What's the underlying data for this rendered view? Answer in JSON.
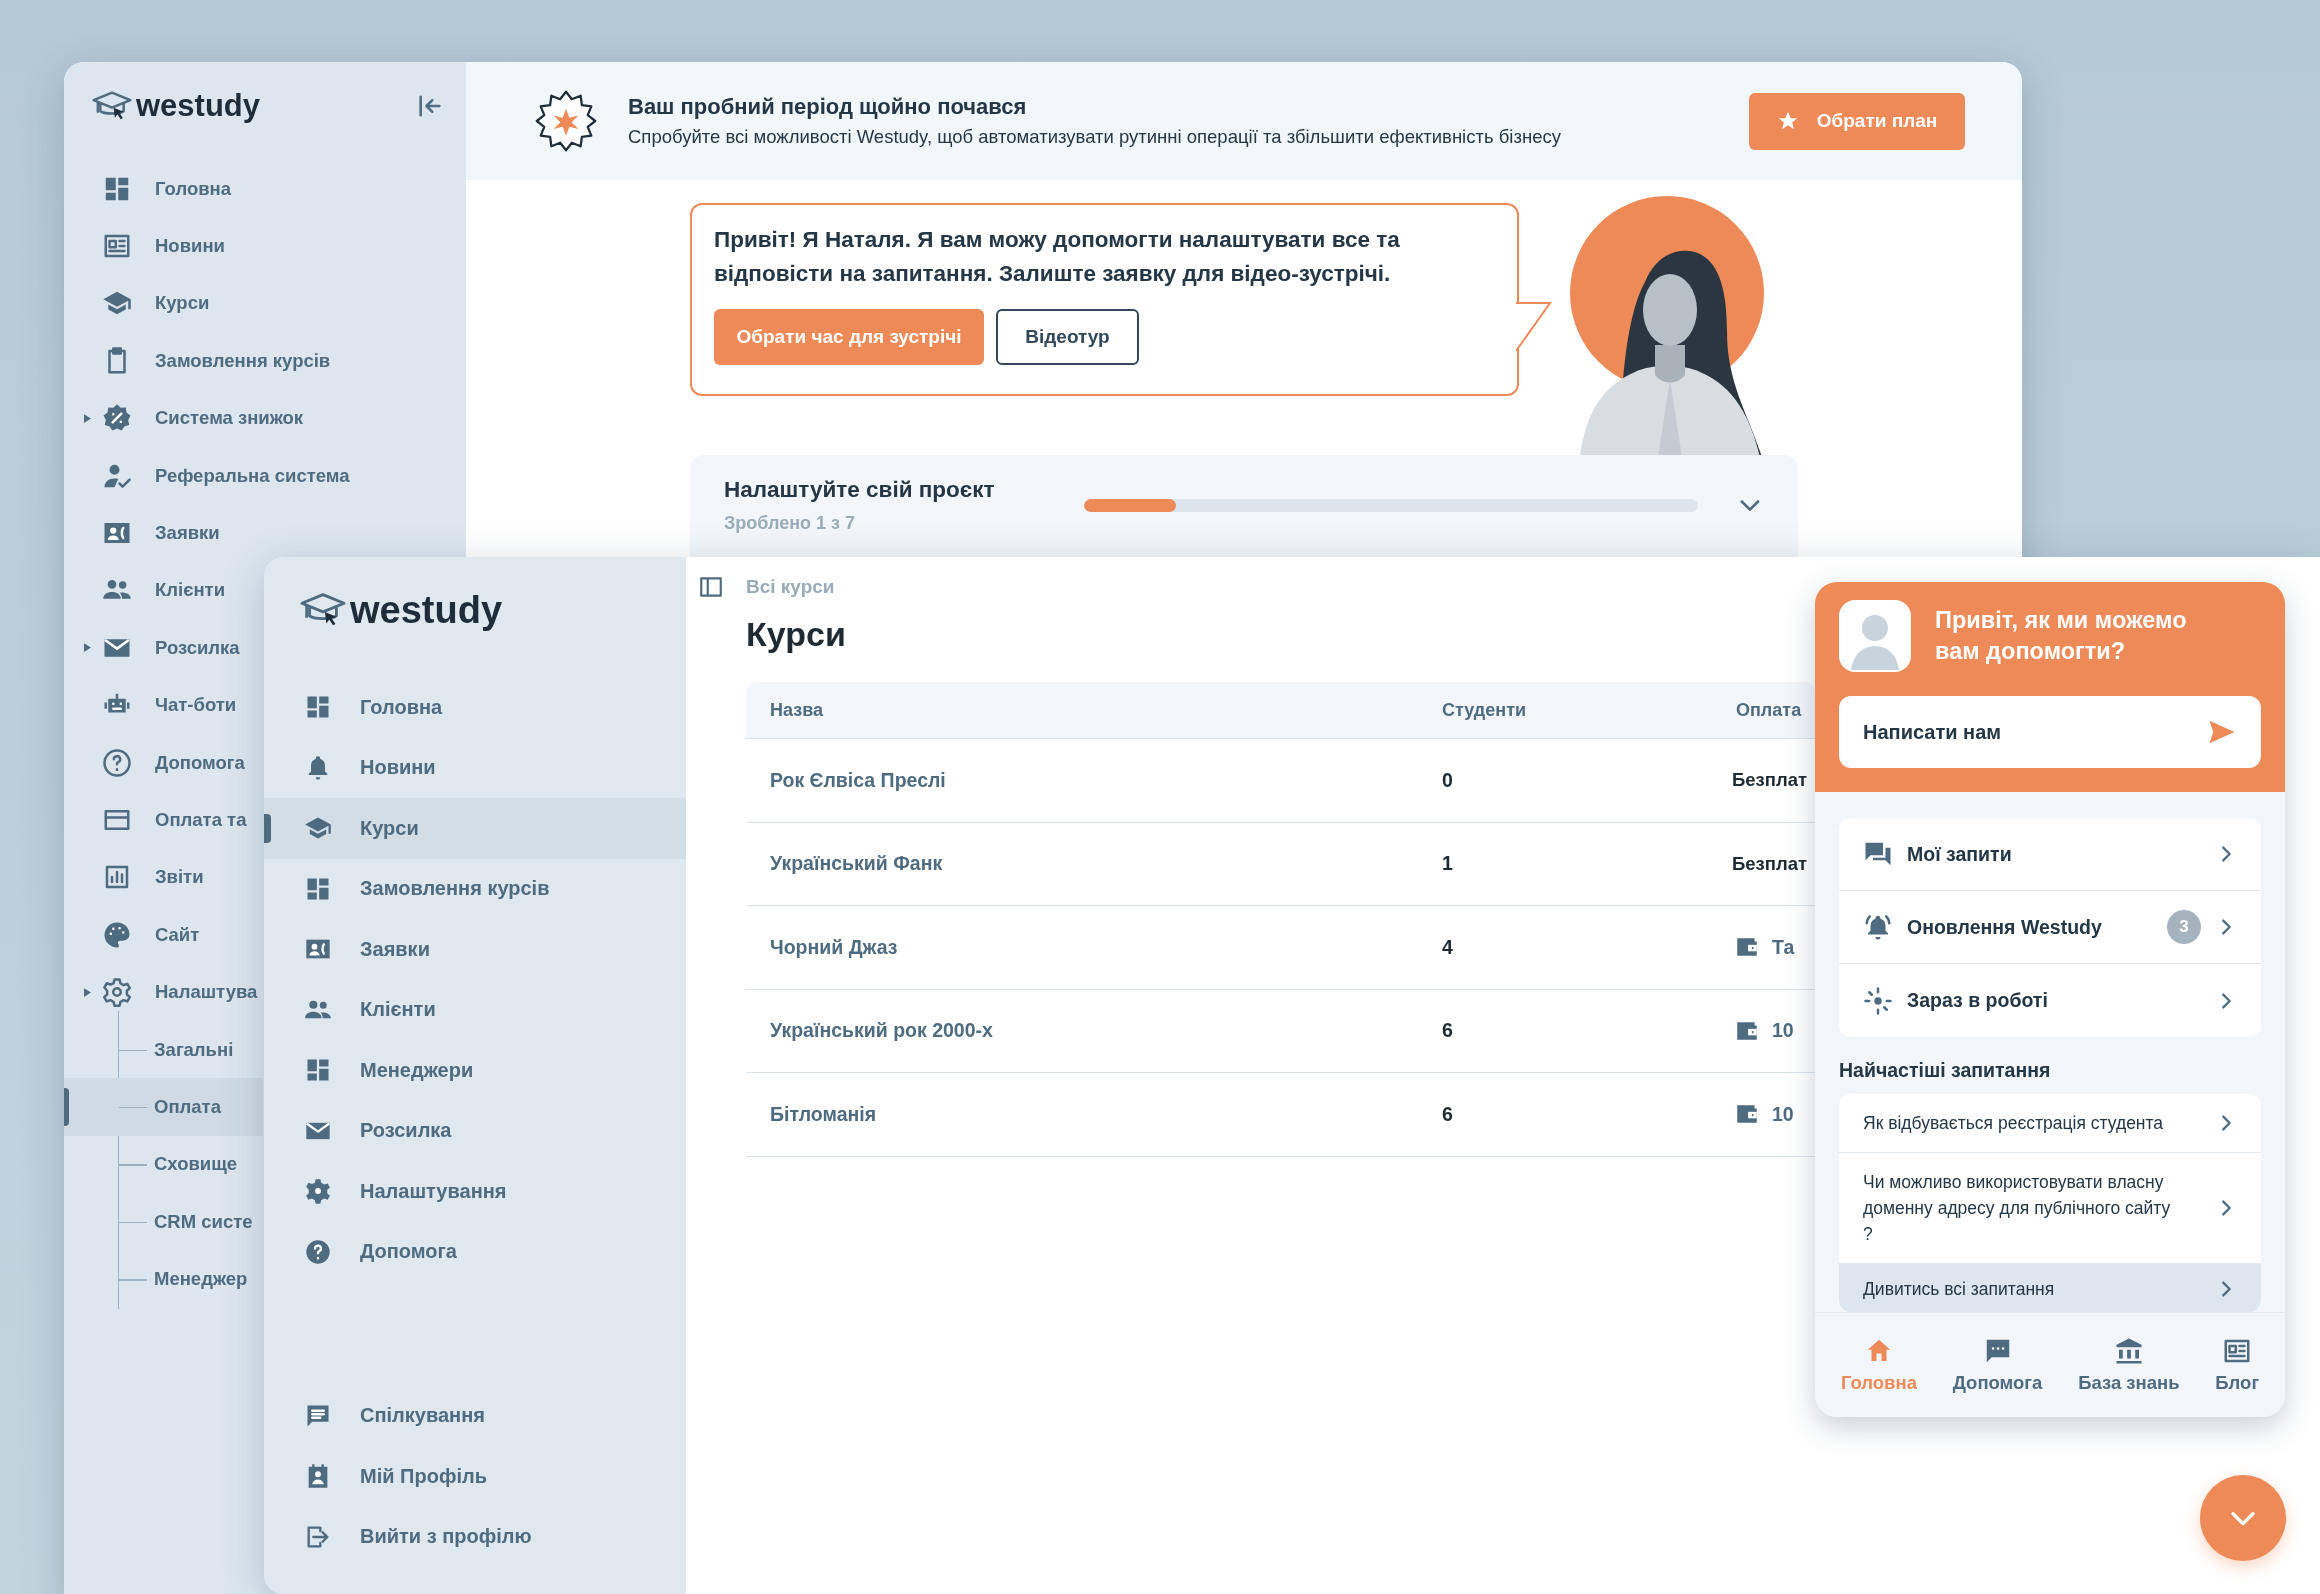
{
  "back_window": {
    "logo": "westudy",
    "sidebar": {
      "items": [
        {
          "label": "Головна",
          "selected": false,
          "expandable": false
        },
        {
          "label": "Новини",
          "selected": false,
          "expandable": false
        },
        {
          "label": "Курси",
          "selected": false,
          "expandable": false
        },
        {
          "label": "Замовлення курсів",
          "selected": false,
          "expandable": false
        },
        {
          "label": "Система знижок",
          "selected": false,
          "expandable": true
        },
        {
          "label": "Реферальна система",
          "selected": false,
          "expandable": false
        },
        {
          "label": "Заявки",
          "selected": false,
          "expandable": false
        },
        {
          "label": "Клієнти",
          "selected": false,
          "expandable": false
        },
        {
          "label": "Розсилка",
          "selected": false,
          "expandable": true
        },
        {
          "label": "Чат-боти",
          "selected": false,
          "expandable": false
        },
        {
          "label": "Допомога",
          "selected": false,
          "expandable": false
        },
        {
          "label": "Оплата та",
          "selected": false,
          "expandable": false
        },
        {
          "label": "Звіти",
          "selected": false,
          "expandable": false
        },
        {
          "label": "Сайт",
          "selected": false,
          "expandable": false
        },
        {
          "label": "Налаштува",
          "selected": false,
          "expandable": true,
          "children": [
            {
              "label": "Загальні",
              "selected": false
            },
            {
              "label": "Оплата",
              "selected": true
            },
            {
              "label": "Сховище",
              "selected": false
            },
            {
              "label": "CRM систе",
              "selected": false
            },
            {
              "label": "Менеджер",
              "selected": false
            }
          ]
        }
      ]
    },
    "banner": {
      "title": "Ваш пробний період щойно почався",
      "text": "Спробуйте всі можливості Westudy, щоб автоматизувати рутинні операції та збільшити ефективність бізнесу",
      "button": "Обрати план"
    },
    "assistant_card": {
      "message": "Привіт! Я Наталя. Я вам можу допомогти налаштувати все та відповісти на запитання. Залиште заявку для відео-зустрічі.",
      "buttons": [
        {
          "label": "Обрати час для зустрічі",
          "kind": "primary"
        },
        {
          "label": "Відеотур",
          "kind": "outline"
        }
      ]
    },
    "setup_card": {
      "title": "Налаштуйте свій проєкт",
      "progress_text": "Зроблено 1 з 7",
      "level": 0.15
    }
  },
  "front_window": {
    "logo": "westudy",
    "sidebar": {
      "items": [
        {
          "label": "Головна",
          "selected": false
        },
        {
          "label": "Новини",
          "selected": false
        },
        {
          "label": "Курси",
          "selected": true
        },
        {
          "label": "Замовлення курсів",
          "selected": false
        },
        {
          "label": "Заявки",
          "selected": false
        },
        {
          "label": "Клієнти",
          "selected": false
        },
        {
          "label": "Менеджери",
          "selected": false
        },
        {
          "label": "Розсилка",
          "selected": false
        },
        {
          "label": "Налаштування",
          "selected": false
        },
        {
          "label": "Допомога",
          "selected": false
        }
      ],
      "bottom_items": [
        {
          "label": "Спілкування",
          "selected": false
        },
        {
          "label": "Мій Профіль",
          "selected": false
        },
        {
          "label": "Вийти з профілю",
          "selected": false
        }
      ]
    },
    "breadcrumb": "Всі курси",
    "title": "Курси",
    "table": {
      "columns": [
        "Назва",
        "Студенти",
        "Оплата"
      ],
      "rows": [
        {
          "name": "Рок Єлвіса Преслі",
          "students": "0",
          "payment": "Безплат",
          "kind": "free"
        },
        {
          "name": "Український Фанк",
          "students": "1",
          "payment": "Безплат",
          "kind": "free"
        },
        {
          "name": "Чорний Джаз",
          "students": "4",
          "payment": "Та",
          "kind": "paid"
        },
        {
          "name": "Український рок 2000-х",
          "students": "6",
          "payment": "10",
          "kind": "paid"
        },
        {
          "name": "Бітломанія",
          "students": "6",
          "payment": "10",
          "kind": "paid"
        }
      ]
    }
  },
  "help_widget": {
    "title": "Привіт, як ми можемо вам допомогти?",
    "write_button": "Написати нам",
    "links": [
      {
        "label": "Мої запити"
      },
      {
        "label": "Оновлення Westudy",
        "badge": "3"
      },
      {
        "label": "Зараз в роботі"
      }
    ],
    "faq_title": "Найчастіші запитання",
    "faq": [
      "Як відбувається реєстрація студента",
      "Чи можливо використовувати власну доменну адресу для публічного сайту ?"
    ],
    "all_questions": "Дивитись всі запитання",
    "nav": [
      {
        "label": "Головна",
        "selected": true
      },
      {
        "label": "Допомога",
        "selected": false
      },
      {
        "label": "База знань",
        "selected": false
      },
      {
        "label": "Блог",
        "selected": false
      }
    ]
  }
}
